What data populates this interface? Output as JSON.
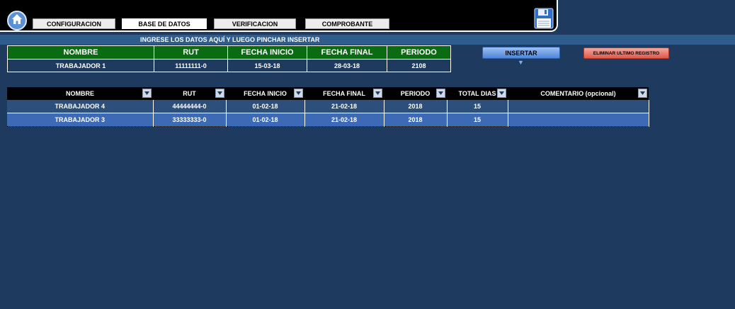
{
  "nav": {
    "items": [
      {
        "label": "CONFIGURACION"
      },
      {
        "label": "BASE DE DATOS"
      },
      {
        "label": "VERIFICACION"
      },
      {
        "label": "COMPROBANTE"
      }
    ],
    "active": "BASE DE DATOS"
  },
  "entry": {
    "instruction": "INGRESE LOS DATOS AQUÍ Y LUEGO PINCHAR INSERTAR",
    "headers": [
      "NOMBRE",
      "RUT",
      "FECHA INICIO",
      "FECHA FINAL",
      "PERIODO"
    ],
    "row": [
      "TRABAJADOR 1",
      "11111111-0",
      "15-03-18",
      "28-03-18",
      "2108"
    ]
  },
  "actions": {
    "insert_label": "INSERTAR",
    "delete_label": "ELIMINAR ULTIMO REGISTRO",
    "insert_color": "#4f86d8",
    "delete_color": "#e0584a"
  },
  "database": {
    "headers": [
      "NOMBRE",
      "RUT",
      "FECHA INICIO",
      "FECHA FINAL",
      "PERIODO",
      "TOTAL DIAS",
      "COMENTARIO (opcional)"
    ],
    "rows": [
      [
        "TRABAJADOR 4",
        "44444444-0",
        "01-02-18",
        "21-02-18",
        "2018",
        "15",
        ""
      ],
      [
        "TRABAJADOR 3",
        "33333333-0",
        "01-02-18",
        "21-02-18",
        "2018",
        "15",
        ""
      ]
    ]
  },
  "colors": {
    "background": "#1f3a5f",
    "entry_header": "#0b6b12",
    "row_selected": "#3d6ab4"
  },
  "icons": {
    "home": "home-icon",
    "save": "floppy-disk-icon",
    "dropdown": "dropdown-arrow-icon"
  }
}
